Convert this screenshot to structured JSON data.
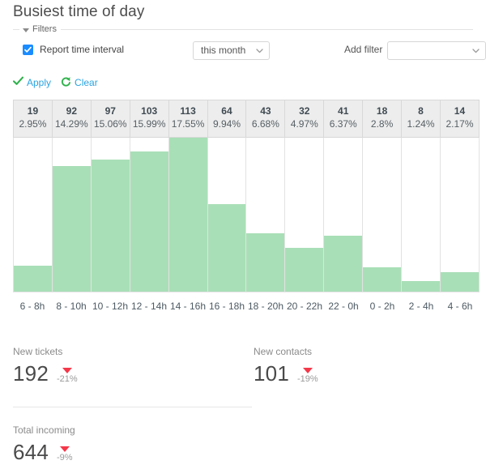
{
  "header": {
    "title": "Busiest time of day"
  },
  "filters": {
    "legend": "Filters",
    "report_time_interval": {
      "label": "Report time interval",
      "checked": true,
      "selected_value": "this month"
    },
    "add_filter": {
      "label": "Add filter",
      "selected_value": ""
    },
    "apply_label": "Apply",
    "clear_label": "Clear"
  },
  "chart_data": {
    "type": "bar",
    "title": "Busiest time of day",
    "xlabel": "",
    "ylabel": "",
    "grid": false,
    "legend": "none",
    "ylim": [
      0,
      113
    ],
    "bar_color": "#a9dfb7",
    "categories": [
      "6 - 8h",
      "8 - 10h",
      "10 - 12h",
      "12 - 14h",
      "14 - 16h",
      "16 - 18h",
      "18 - 20h",
      "20 - 22h",
      "22 - 0h",
      "0 - 2h",
      "2 - 4h",
      "4 - 6h"
    ],
    "values": [
      19,
      92,
      97,
      103,
      113,
      64,
      43,
      32,
      41,
      18,
      8,
      14
    ],
    "percents": [
      "2.95%",
      "14.29%",
      "15.06%",
      "15.99%",
      "17.55%",
      "9.94%",
      "6.68%",
      "4.97%",
      "6.37%",
      "2.8%",
      "1.24%",
      "2.17%"
    ],
    "columns": [
      {
        "count": "19",
        "percent": "2.95%",
        "value": 19,
        "label": "6 - 8h"
      },
      {
        "count": "92",
        "percent": "14.29%",
        "value": 92,
        "label": "8 - 10h"
      },
      {
        "count": "97",
        "percent": "15.06%",
        "value": 97,
        "label": "10 - 12h"
      },
      {
        "count": "103",
        "percent": "15.99%",
        "value": 103,
        "label": "12 - 14h"
      },
      {
        "count": "113",
        "percent": "17.55%",
        "value": 113,
        "label": "14 - 16h"
      },
      {
        "count": "64",
        "percent": "9.94%",
        "value": 64,
        "label": "16 - 18h"
      },
      {
        "count": "43",
        "percent": "6.68%",
        "value": 43,
        "label": "18 - 20h"
      },
      {
        "count": "32",
        "percent": "4.97%",
        "value": 32,
        "label": "20 - 22h"
      },
      {
        "count": "41",
        "percent": "6.37%",
        "value": 41,
        "label": "22 - 0h"
      },
      {
        "count": "18",
        "percent": "2.8%",
        "value": 18,
        "label": "0 - 2h"
      },
      {
        "count": "8",
        "percent": "1.24%",
        "value": 8,
        "label": "2 - 4h"
      },
      {
        "count": "14",
        "percent": "2.17%",
        "value": 14,
        "label": "4 - 6h"
      }
    ]
  },
  "kpis": [
    {
      "label": "New tickets",
      "value": "192",
      "delta": "-21%",
      "direction": "down",
      "delta_color": "#f4384a"
    },
    {
      "label": "New contacts",
      "value": "101",
      "delta": "-19%",
      "direction": "down",
      "delta_color": "#f4384a"
    },
    {
      "label": "Total incoming",
      "value": "644",
      "delta": "-9%",
      "direction": "down",
      "delta_color": "#f4384a"
    }
  ]
}
